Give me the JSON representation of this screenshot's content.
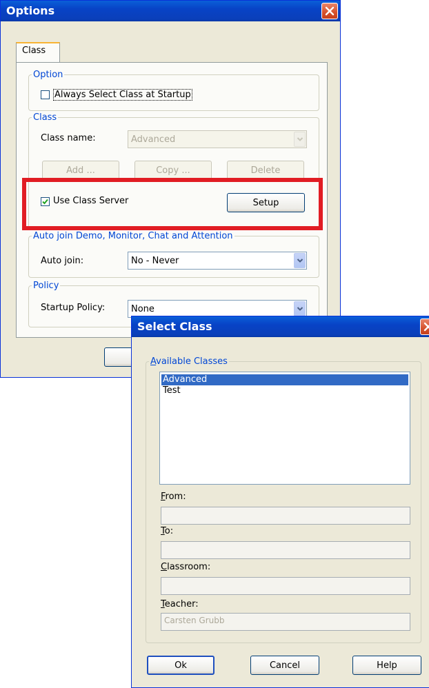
{
  "options_dialog": {
    "title": "Options",
    "tab_label": "Class",
    "option_group": {
      "legend": "Option",
      "always_select_label_prefix": "",
      "always_select_label": "Always Select Class at Startup",
      "always_select_checked": false
    },
    "class_group": {
      "legend": "Class",
      "class_name_label": "Class name:",
      "class_name_value": "Advanced",
      "add_label": "Add ...",
      "copy_label": "Copy ...",
      "delete_label": "Delete",
      "use_class_server_label": "Use Class Server",
      "use_class_server_checked": true,
      "setup_label": "Setup"
    },
    "autojoin_group": {
      "legend": "Auto join Demo, Monitor, Chat and Attention",
      "auto_join_label": "Auto join:",
      "auto_join_value": "No - Never"
    },
    "policy_group": {
      "legend": "Policy",
      "startup_policy_label": "Startup Policy:",
      "startup_policy_value": "None"
    }
  },
  "select_class_dialog": {
    "title": "Select Class",
    "available_classes_legend_first": "A",
    "available_classes_legend_rest": "vailable Classes",
    "classes": [
      "Advanced",
      "Test"
    ],
    "selected_index": 0,
    "from_first": "F",
    "from_rest": "rom:",
    "from_value": "",
    "to_first": "T",
    "to_rest": "o:",
    "to_value": "",
    "classroom_first": "C",
    "classroom_rest": "lassroom:",
    "classroom_value": "",
    "teacher_first": "T",
    "teacher_rest": "eacher:",
    "teacher_value": "Carsten Grubb",
    "ok_label": "Ok",
    "cancel_label": "Cancel",
    "help_label": "Help"
  },
  "colors": {
    "title_bar": "#0a5fd8",
    "window_bg": "#ece9d8",
    "highlight": "#e11d24",
    "group_legend": "#0046d5",
    "selection": "#316ac5"
  }
}
